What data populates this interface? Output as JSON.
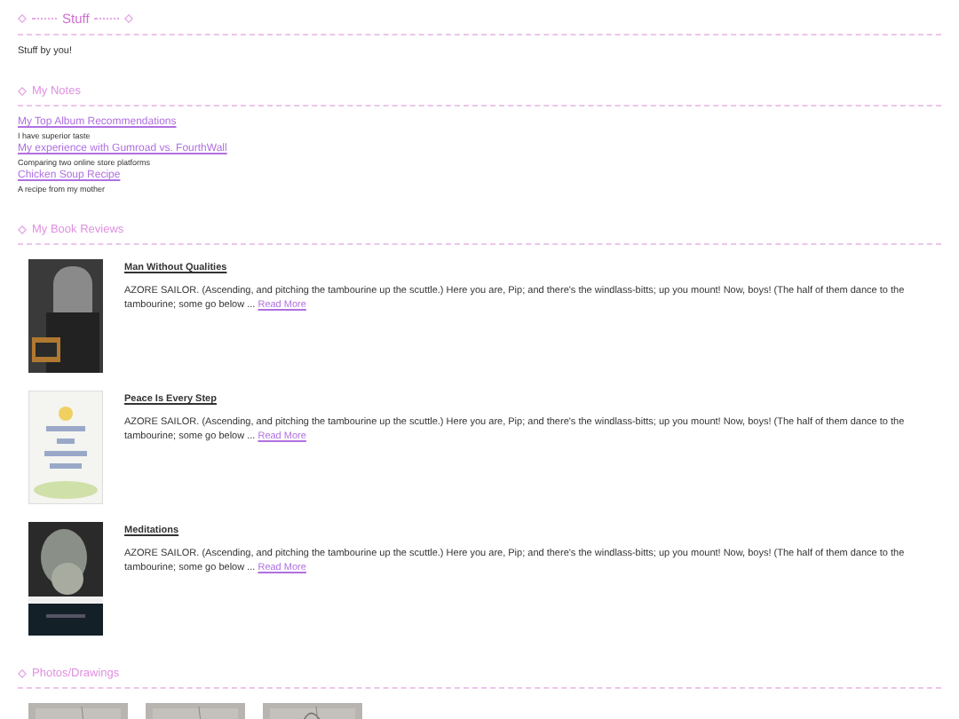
{
  "header": {
    "title": "Stuff"
  },
  "intro": "Stuff by you!",
  "notes": {
    "heading": "My Notes",
    "items": [
      {
        "title": "My Top Album Recommendations",
        "description": "I have superior taste"
      },
      {
        "title": "My experience with Gumroad vs. FourthWall",
        "description": "Comparing two online store platforms"
      },
      {
        "title": "Chicken Soup Recipe",
        "description": "A recipe from my mother"
      }
    ]
  },
  "book_reviews": {
    "heading": "My Book Reviews",
    "items": [
      {
        "title": "Man Without Qualities",
        "excerpt": "AZORE SAILOR. (Ascending, and pitching the tambourine up the scuttle.) Here you are, Pip; and there's the windlass-bitts; up you mount! Now, boys! (The half of them dance to the tambourine; some go below ...",
        "link": "Read More"
      },
      {
        "title": "Peace Is Every Step",
        "excerpt": "AZORE SAILOR. (Ascending, and pitching the tambourine up the scuttle.) Here you are, Pip; and there's the windlass-bitts; up you mount! Now, boys! (The half of them dance to the tambourine; some go below ...",
        "link": "Read More"
      },
      {
        "title": "Meditations",
        "excerpt": "AZORE SAILOR. (Ascending, and pitching the tambourine up the scuttle.) Here you are, Pip; and there's the windlass-bitts; up you mount! Now, boys! (The half of them dance to the tambourine; some go below ...",
        "link": "Read More"
      }
    ]
  },
  "photos": {
    "heading": "Photos/Drawings"
  }
}
